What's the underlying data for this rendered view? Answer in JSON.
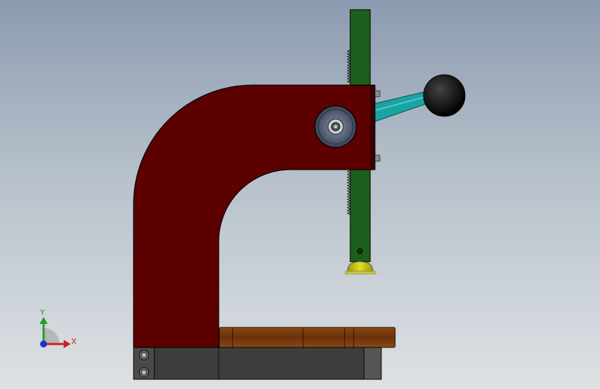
{
  "viewport": {
    "background_top": "#8b9bb0",
    "background_bottom": "#dde1e4"
  },
  "model": {
    "frame_color": "#5c0000",
    "rack_color": "#1c5e1c",
    "handle_color": "#1aa3a3",
    "knob_color": "#111111",
    "base_color": "#3a3a3a",
    "work_plate_color": "#7a3b0c",
    "tip_color": "#c8c800"
  },
  "triad": {
    "x_label": "X",
    "y_label": "Y",
    "x_color": "#cc2020",
    "y_color": "#20a020",
    "z_color": "#2030c0"
  }
}
